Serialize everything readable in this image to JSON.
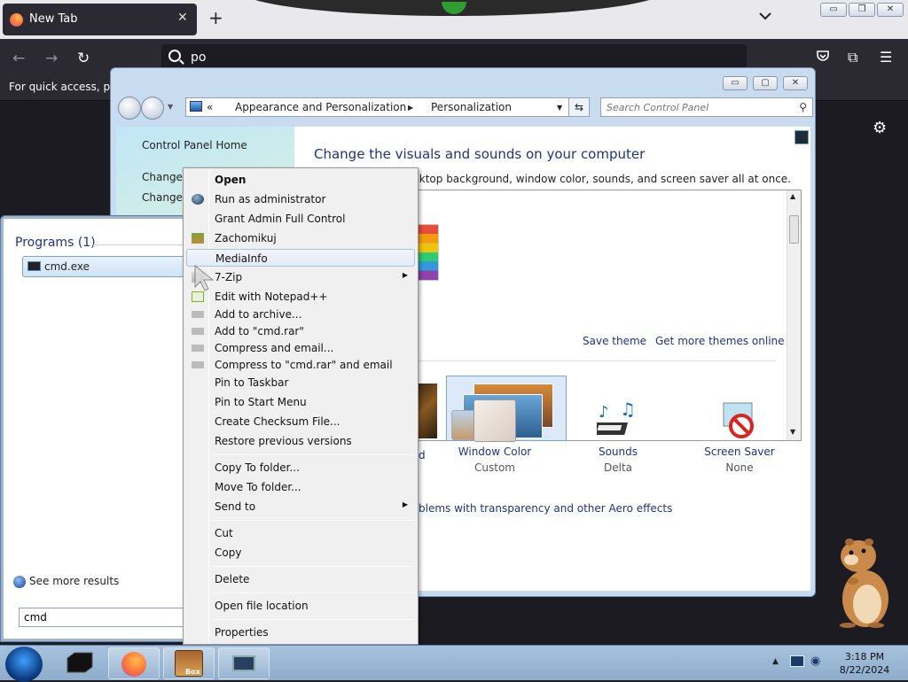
{
  "firefox": {
    "tab_title": "New Tab",
    "url_text": "po",
    "bookmarks_text": "For quick access, plac",
    "new_tab_symbol": "+",
    "icons": [
      "firefox-icon",
      "close-icon",
      "plus-icon",
      "chevron-down-icon",
      "back-icon",
      "forward-icon",
      "reload-icon",
      "search-icon",
      "pocket-icon",
      "extensions-icon",
      "menu-icon",
      "gear-icon"
    ]
  },
  "control_panel": {
    "address": {
      "chevron": "«",
      "crumb1": "Appearance and Personalization",
      "crumb2": "Personalization"
    },
    "search_placeholder": "Search Control Panel",
    "sidebar": {
      "home": "Control Panel Home",
      "link1": "Change",
      "link2": "Change"
    },
    "heading": "Change the visuals and sounds on your computer",
    "description": "ge the desktop background, window color, sounds, and screen saver all at once.",
    "save_theme": "Save theme",
    "get_more_themes": "Get more themes online",
    "bottom_partial": "d",
    "window_color": {
      "label": "Window Color",
      "value": "Custom"
    },
    "sounds": {
      "label": "Sounds",
      "value": "Delta"
    },
    "screen_saver": {
      "label": "Screen Saver",
      "value": "None"
    },
    "aero_link": "blems with transparency and other Aero effects"
  },
  "start_menu": {
    "programs_header": "Programs (1)",
    "program": "cmd.exe",
    "see_more": "See more results",
    "search_value": "cmd"
  },
  "context_menu": {
    "items": [
      {
        "label": "Open",
        "bold": true
      },
      {
        "label": "Run as administrator"
      },
      {
        "label": "Grant Admin Full Control"
      },
      {
        "label": "Zachomikuj"
      },
      {
        "label": "MediaInfo",
        "highlighted": true
      },
      {
        "label": "7-Zip",
        "submenu": true
      },
      {
        "label": "Edit with Notepad++"
      },
      {
        "label": "Add to archive..."
      },
      {
        "label": "Add to \"cmd.rar\""
      },
      {
        "label": "Compress and email..."
      },
      {
        "label": "Compress to \"cmd.rar\" and email"
      },
      {
        "label": "Pin to Taskbar"
      },
      {
        "label": "Pin to Start Menu"
      },
      {
        "label": "Create Checksum File..."
      },
      {
        "label": "Restore previous versions"
      },
      {
        "label": "Copy To folder..."
      },
      {
        "label": "Move To folder..."
      },
      {
        "label": "Send to",
        "submenu": true
      },
      {
        "label": "Cut"
      },
      {
        "label": "Copy"
      },
      {
        "label": "Delete"
      },
      {
        "label": "Open file location"
      },
      {
        "label": "Properties"
      }
    ]
  },
  "taskbar": {
    "time": "3:18 PM",
    "date": "8/22/2024",
    "box_label": "Box"
  },
  "colors": {
    "accent": "#1e3287",
    "menu_highlight": "#a8c3e2",
    "firefox_dark": "#2b2a33"
  }
}
